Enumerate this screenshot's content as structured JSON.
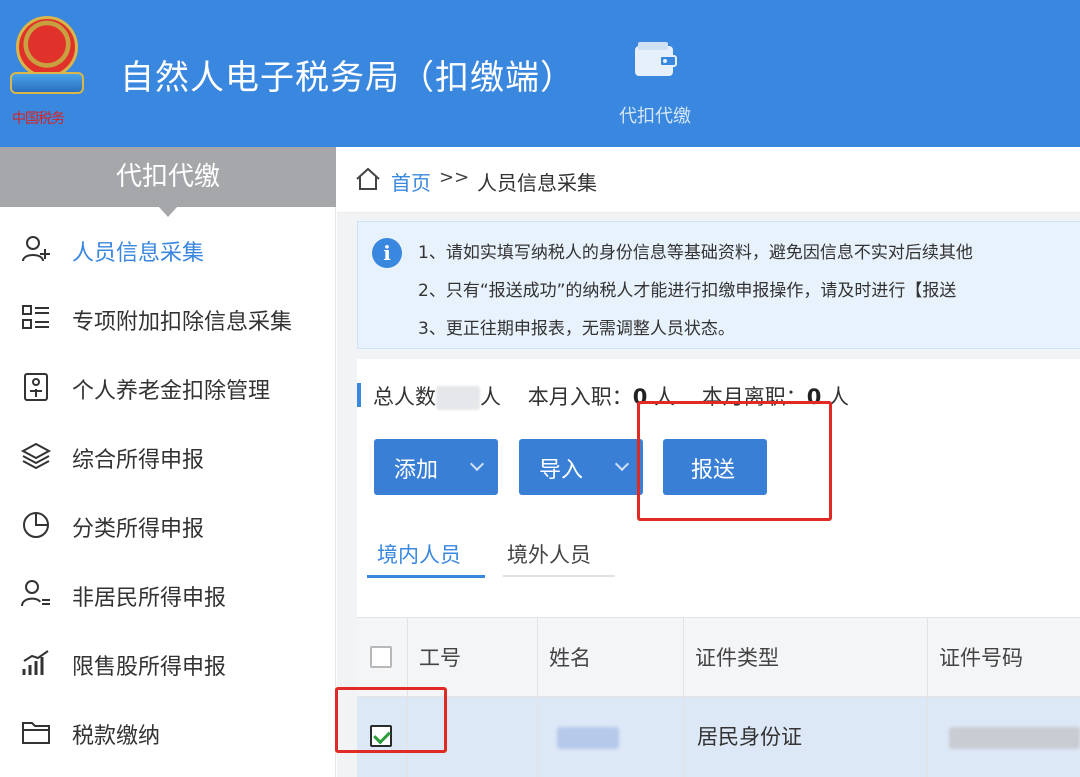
{
  "header": {
    "app_title": "自然人电子税务局（扣缴端）",
    "emblem_caption": "中国税务",
    "nav_label": "代扣代缴",
    "accent_color": "#3a87df"
  },
  "sidebar": {
    "title": "代扣代缴",
    "items": [
      {
        "label": "人员信息采集",
        "icon": "person-add-icon",
        "active": true
      },
      {
        "label": "专项附加扣除信息采集",
        "icon": "list-icon",
        "active": false
      },
      {
        "label": "个人养老金扣除管理",
        "icon": "pension-doc-icon",
        "active": false
      },
      {
        "label": "综合所得申报",
        "icon": "layers-icon",
        "active": false
      },
      {
        "label": "分类所得申报",
        "icon": "pie-chart-icon",
        "active": false
      },
      {
        "label": "非居民所得申报",
        "icon": "person-list-icon",
        "active": false
      },
      {
        "label": "限售股所得申报",
        "icon": "bar-chart-icon",
        "active": false
      },
      {
        "label": "税款缴纳",
        "icon": "folder-icon",
        "active": false
      }
    ]
  },
  "breadcrumb": {
    "home": "首页",
    "separator": ">>",
    "current": "人员信息采集"
  },
  "notice": {
    "lines": [
      "1、请如实填写纳税人的身份信息等基础资料，避免因信息不实对后续其他",
      "2、只有“报送成功”的纳税人才能进行扣缴申报操作，请及时进行【报送",
      "3、更正往期申报表，无需调整人员状态。"
    ]
  },
  "stats": {
    "total_label": "总人数",
    "total_unit": "人",
    "joined_label": "本月入职：",
    "joined_value": "0",
    "joined_unit": "人",
    "left_label": "本月离职：",
    "left_value": "0",
    "left_unit": "人"
  },
  "actions": {
    "add_label": "添加",
    "import_label": "导入",
    "submit_label": "报送"
  },
  "tabs": [
    {
      "label": "境内人员",
      "active": true
    },
    {
      "label": "境外人员",
      "active": false
    }
  ],
  "table": {
    "columns": [
      "工号",
      "姓名",
      "证件类型",
      "证件号码"
    ],
    "rows": [
      {
        "checked": true,
        "id_type": "居民身份证"
      }
    ]
  },
  "highlight_color": "#e02b25"
}
